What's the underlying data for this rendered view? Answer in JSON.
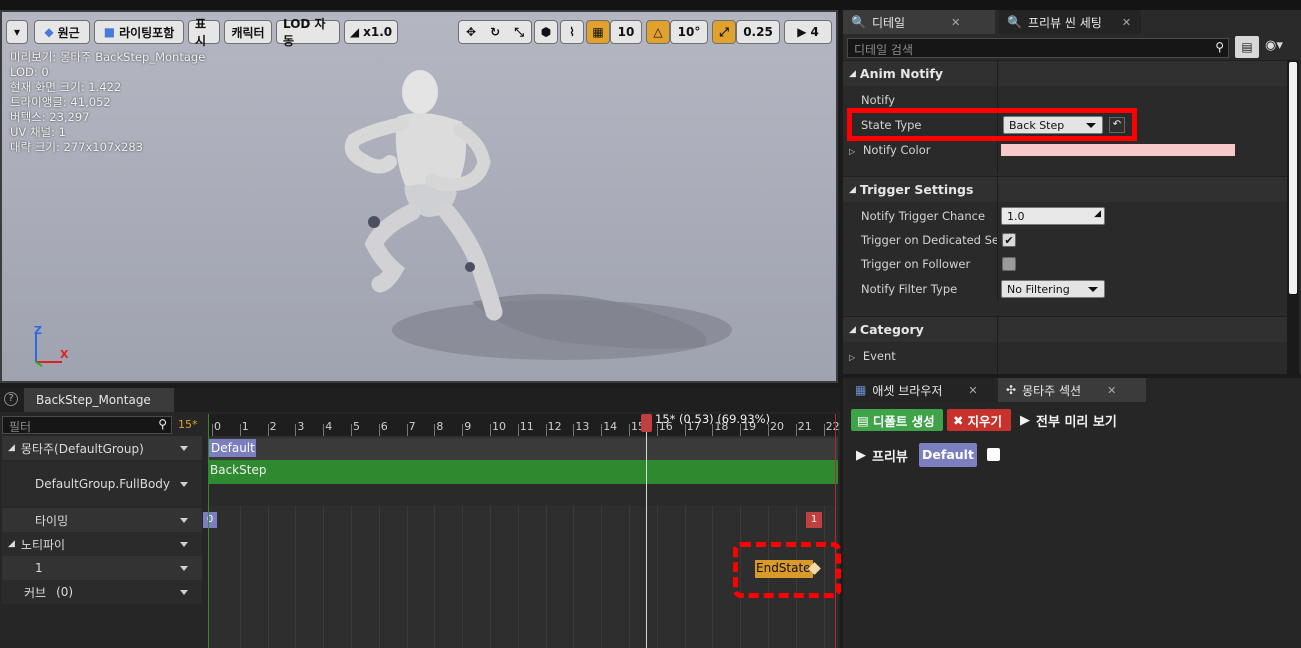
{
  "viewport": {
    "toolbar": {
      "perspective_label": "원근",
      "lighting_label": "라이팅포함",
      "show_label": "표시",
      "character_label": "캐릭터",
      "lod_label": "LOD 자동",
      "speed_label": "x1.0",
      "grid_value": "10",
      "rotation_value": "10°",
      "scale_value": "0.25",
      "camera_speed": "4"
    },
    "stats": [
      "미리보기: 몽타주 BackStep_Montage",
      "LOD: 0",
      "현재 화면 크기: 1.422",
      "트라이앵글: 41,052",
      "버텍스: 23,297",
      "UV 채널: 1",
      "대략 크기: 277x107x283"
    ],
    "axis": {
      "z": "Z",
      "x": "X"
    }
  },
  "details": {
    "tabs": [
      "디테일",
      "프리뷰 씬 세팅"
    ],
    "search_placeholder": "디테일 검색",
    "anim_notify": {
      "title": "Anim Notify",
      "notify_label": "Notify",
      "state_type_label": "State Type",
      "state_type_value": "Back Step",
      "notify_color_label": "Notify Color",
      "notify_color": "#f7c9c9"
    },
    "trigger_settings": {
      "title": "Trigger Settings",
      "chance_label": "Notify Trigger Chance",
      "chance_value": "1.0",
      "dedicated_label": "Trigger on Dedicated Serve",
      "dedicated_checked": true,
      "follower_label": "Trigger on Follower",
      "follower_checked": false,
      "filter_label": "Notify Filter Type",
      "filter_value": "No Filtering"
    },
    "category": {
      "title": "Category",
      "event_label": "Event"
    }
  },
  "timeline": {
    "tab": "BackStep_Montage",
    "filter_placeholder": "필터",
    "frame_indicator": "15*",
    "playhead_label": "15* (0.53) (69.93%)",
    "ticks": [
      "0",
      "1",
      "2",
      "3",
      "4",
      "5",
      "6",
      "7",
      "8",
      "9",
      "10",
      "11",
      "12",
      "13",
      "14",
      "15",
      "16",
      "17",
      "18",
      "19",
      "20",
      "21",
      "22"
    ],
    "rows": {
      "montage": "몽타주(DefaultGroup)",
      "slot": "DefaultGroup.FullBody",
      "timing": "타이밍",
      "notify": "노티파이",
      "notify_track": "1",
      "curves": "커브",
      "curves_count": "(0)"
    },
    "section_label": "Default",
    "segment_label": "BackStep",
    "timing_left": "0",
    "timing_right": "1",
    "notify_state_label": "EndState"
  },
  "montage_sections": {
    "tabs": [
      "애셋 브라우저",
      "몽타주 섹션"
    ],
    "create_default_label": "디폴트 생성",
    "clear_label": "지우기",
    "preview_all_label": "전부 미리 보기",
    "preview_label": "프리뷰",
    "default_section": "Default"
  },
  "colors": {
    "highlight_red": "#ff0000",
    "segment_green": "#2f8a2f",
    "section_purple": "#7b7fc0",
    "notify_orange": "#d99a2a"
  }
}
